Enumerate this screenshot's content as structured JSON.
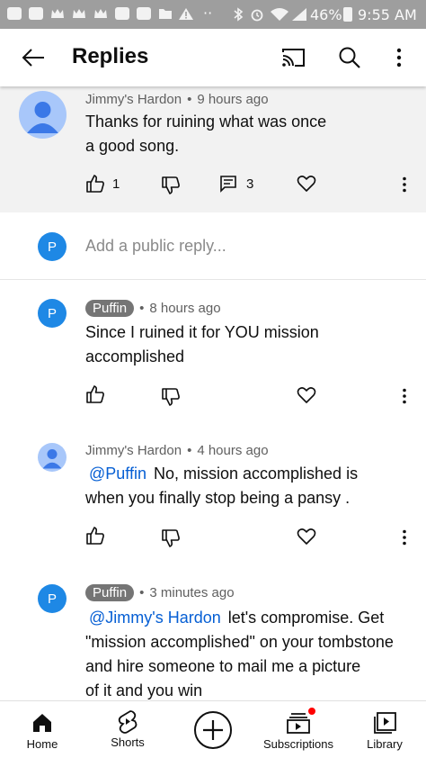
{
  "status_bar": {
    "battery": "46%",
    "time": "9:55 AM",
    "overflow_dots": "··"
  },
  "header": {
    "title": "Replies"
  },
  "parent_comment": {
    "author": "Jimmy's Hardon",
    "time": "9 hours ago",
    "lines": [
      "Thanks for ruining what was once",
      "a good song."
    ],
    "likes": "1",
    "replies": "3"
  },
  "reply_box": {
    "avatar_letter": "P",
    "placeholder": "Add a public reply..."
  },
  "replies": [
    {
      "author": "Puffin",
      "author_is_chip": true,
      "time": "8 hours ago",
      "avatar_letter": "P",
      "mention": "",
      "lines": [
        "Since I ruined it for YOU mission",
        "accomplished"
      ]
    },
    {
      "author": "Jimmy's Hardon",
      "author_is_chip": false,
      "time": "4 hours ago",
      "avatar_letter": "",
      "mention": "@Puffin",
      "lines": [
        "No, mission accomplished is",
        "when you finally stop being a pansy ."
      ]
    },
    {
      "author": "Puffin",
      "author_is_chip": true,
      "time": "3 minutes ago",
      "avatar_letter": "P",
      "mention": "@Jimmy's Hardon",
      "lines": [
        "let's compromise. Get",
        "\"mission accomplished\" on your tombstone",
        "and hire someone to mail me a picture",
        "of it and you win"
      ]
    }
  ],
  "bottom_nav": {
    "items": [
      {
        "label": "Home",
        "icon": "home-icon"
      },
      {
        "label": "Shorts",
        "icon": "shorts-icon"
      },
      {
        "label": "",
        "icon": "create-icon"
      },
      {
        "label": "Subscriptions",
        "icon": "subscriptions-icon"
      },
      {
        "label": "Library",
        "icon": "library-icon"
      }
    ]
  },
  "colors": {
    "mention": "#065fd4",
    "avatar_p": "#1e88e5",
    "chip": "#757575",
    "notification_dot": "#ff0000"
  }
}
